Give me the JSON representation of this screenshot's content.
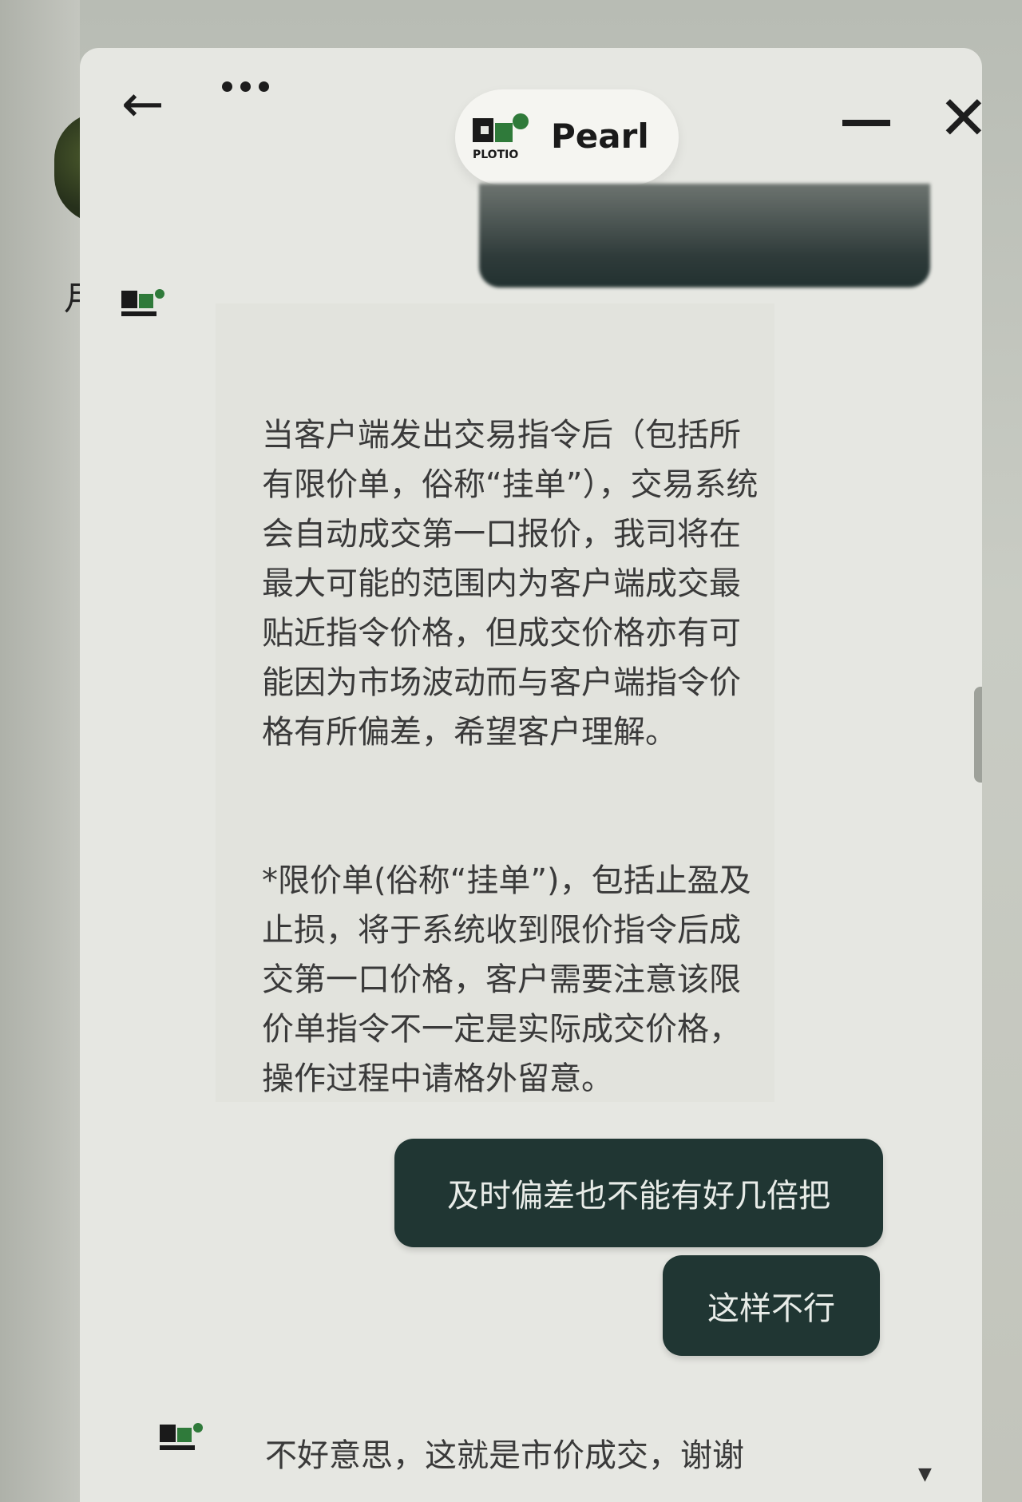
{
  "left_panel": {
    "partial_char": "月"
  },
  "header": {
    "back_icon": "arrow-left-icon",
    "more_icon": "more-horizontal-icon",
    "title": "Pearl",
    "brand_logo_text": "PLOTIO",
    "minimize_icon": "minimize-icon",
    "close_icon": "close-icon"
  },
  "messages": [
    {
      "from": "bot",
      "paragraphs": [
        "当客户端发出交易指令后（包括所有限价单，俗称“挂单”），交易系统会自动成交第一口报价，我司将在最大可能的范围内为客户端成交最贴近指令价格，但成交价格亦有可能因为市场波动而与客户端指令价格有所偏差，希望客户理解。",
        "*限价单(俗称“挂单”)，包括止盈及止损，将于系统收到限价指令后成交第一口价格，客户需要注意该限价单指令不一定是实际成交价格，操作过程中请格外留意。"
      ]
    },
    {
      "from": "user",
      "text": "及时偏差也不能有好几倍把"
    },
    {
      "from": "user",
      "text": "这样不行"
    },
    {
      "from": "bot",
      "text": "不好意思，这就是市价成交，谢谢"
    }
  ],
  "colors": {
    "user_bubble": "#203633",
    "user_text": "#e8ece8",
    "bot_text": "#3a3a3a",
    "window_bg": "#e6e7e2",
    "logo_green": "#2f7a3a"
  }
}
